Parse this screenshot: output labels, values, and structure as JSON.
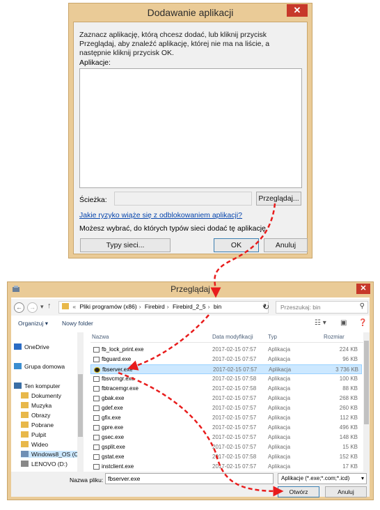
{
  "add_app_dialog": {
    "title": "Dodawanie aplikacji",
    "close_glyph": "✕",
    "instructions": "Zaznacz aplikację, którą chcesz dodać, lub kliknij przycisk Przeglądaj, aby znaleźć aplikację, której nie ma na liście, a następnie kliknij przycisk OK.",
    "apps_label": "Aplikacje:",
    "path_label": "Ścieżka:",
    "path_value": "",
    "browse_label": "Przeglądaj...",
    "risk_link": "Jakie ryzyko wiąże się z odblokowaniem aplikacji?",
    "network_text": "Możesz wybrać, do których typów sieci dodać tę aplikację.",
    "network_types_label": "Typy sieci...",
    "ok_label": "OK",
    "cancel_label": "Anuluj"
  },
  "browse_dialog": {
    "title": "Przeglądaj",
    "close_glyph": "✕",
    "breadcrumbs": [
      "«",
      "Pliki programów (x86)",
      "Firebird",
      "Firebird_2_5",
      "bin"
    ],
    "search_placeholder": "Przeszukaj: bin",
    "toolbar": {
      "organize": "Organizuj ▾",
      "new_folder": "Nowy folder"
    },
    "nav_items": [
      {
        "label": "OneDrive",
        "icon": "cloud-icon",
        "color": "#2b6cc4"
      },
      {
        "label": "Grupa domowa",
        "icon": "homegroup-icon",
        "color": "#3b8ed0"
      },
      {
        "label": "Ten komputer",
        "icon": "computer-icon",
        "color": "#3a6ea5"
      },
      {
        "label": "Dokumenty",
        "icon": "folder-icon",
        "color": "#e8b84a"
      },
      {
        "label": "Muzyka",
        "icon": "folder-icon",
        "color": "#e8b84a"
      },
      {
        "label": "Obrazy",
        "icon": "folder-icon",
        "color": "#e8b84a"
      },
      {
        "label": "Pobrane",
        "icon": "folder-icon",
        "color": "#e8b84a"
      },
      {
        "label": "Pulpit",
        "icon": "folder-icon",
        "color": "#e8b84a"
      },
      {
        "label": "Wideo",
        "icon": "folder-icon",
        "color": "#e8b84a"
      },
      {
        "label": "Windows8_OS (C",
        "icon": "drive-icon",
        "color": "#6f8fb5"
      },
      {
        "label": "LENOVO (D:)",
        "icon": "drive-icon",
        "color": "#888888"
      }
    ],
    "columns": {
      "name": "Nazwa",
      "date": "Data modyfikacji",
      "type": "Typ",
      "size": "Rozmiar"
    },
    "files": [
      {
        "name": "fb_lock_print.exe",
        "date": "2017-02-15 07:57",
        "type": "Aplikacja",
        "size": "224 KB",
        "selected": false
      },
      {
        "name": "fbguard.exe",
        "date": "2017-02-15 07:57",
        "type": "Aplikacja",
        "size": "96 KB",
        "selected": false
      },
      {
        "name": "fbserver.exe",
        "date": "2017-02-15 07:57",
        "type": "Aplikacja",
        "size": "3 736 KB",
        "selected": true
      },
      {
        "name": "fbsvcmgr.exe",
        "date": "2017-02-15 07:58",
        "type": "Aplikacja",
        "size": "100 KB",
        "selected": false
      },
      {
        "name": "fbtracemgr.exe",
        "date": "2017-02-15 07:58",
        "type": "Aplikacja",
        "size": "88 KB",
        "selected": false
      },
      {
        "name": "gbak.exe",
        "date": "2017-02-15 07:57",
        "type": "Aplikacja",
        "size": "268 KB",
        "selected": false
      },
      {
        "name": "gdef.exe",
        "date": "2017-02-15 07:57",
        "type": "Aplikacja",
        "size": "260 KB",
        "selected": false
      },
      {
        "name": "gfix.exe",
        "date": "2017-02-15 07:57",
        "type": "Aplikacja",
        "size": "112 KB",
        "selected": false
      },
      {
        "name": "gpre.exe",
        "date": "2017-02-15 07:57",
        "type": "Aplikacja",
        "size": "496 KB",
        "selected": false
      },
      {
        "name": "gsec.exe",
        "date": "2017-02-15 07:57",
        "type": "Aplikacja",
        "size": "148 KB",
        "selected": false
      },
      {
        "name": "gsplit.exe",
        "date": "2017-02-15 07:57",
        "type": "Aplikacja",
        "size": "15 KB",
        "selected": false
      },
      {
        "name": "gstat.exe",
        "date": "2017-02-15 07:58",
        "type": "Aplikacja",
        "size": "152 KB",
        "selected": false
      },
      {
        "name": "instclient.exe",
        "date": "2017-02-15 07:57",
        "type": "Aplikacja",
        "size": "17 KB",
        "selected": false
      }
    ],
    "filename_label": "Nazwa pliku:",
    "filename_value": "fbserver.exe",
    "filetype_value": "Aplikacje (*.exe;*.com;*.icd)",
    "open_label": "Otwórz",
    "cancel_label": "Anuluj"
  },
  "colors": {
    "title_bar": "#eacb97",
    "close_button": "#c7382a",
    "selection": "#cce8ff",
    "arrow": "#e81c1c",
    "link": "#0645ad"
  }
}
